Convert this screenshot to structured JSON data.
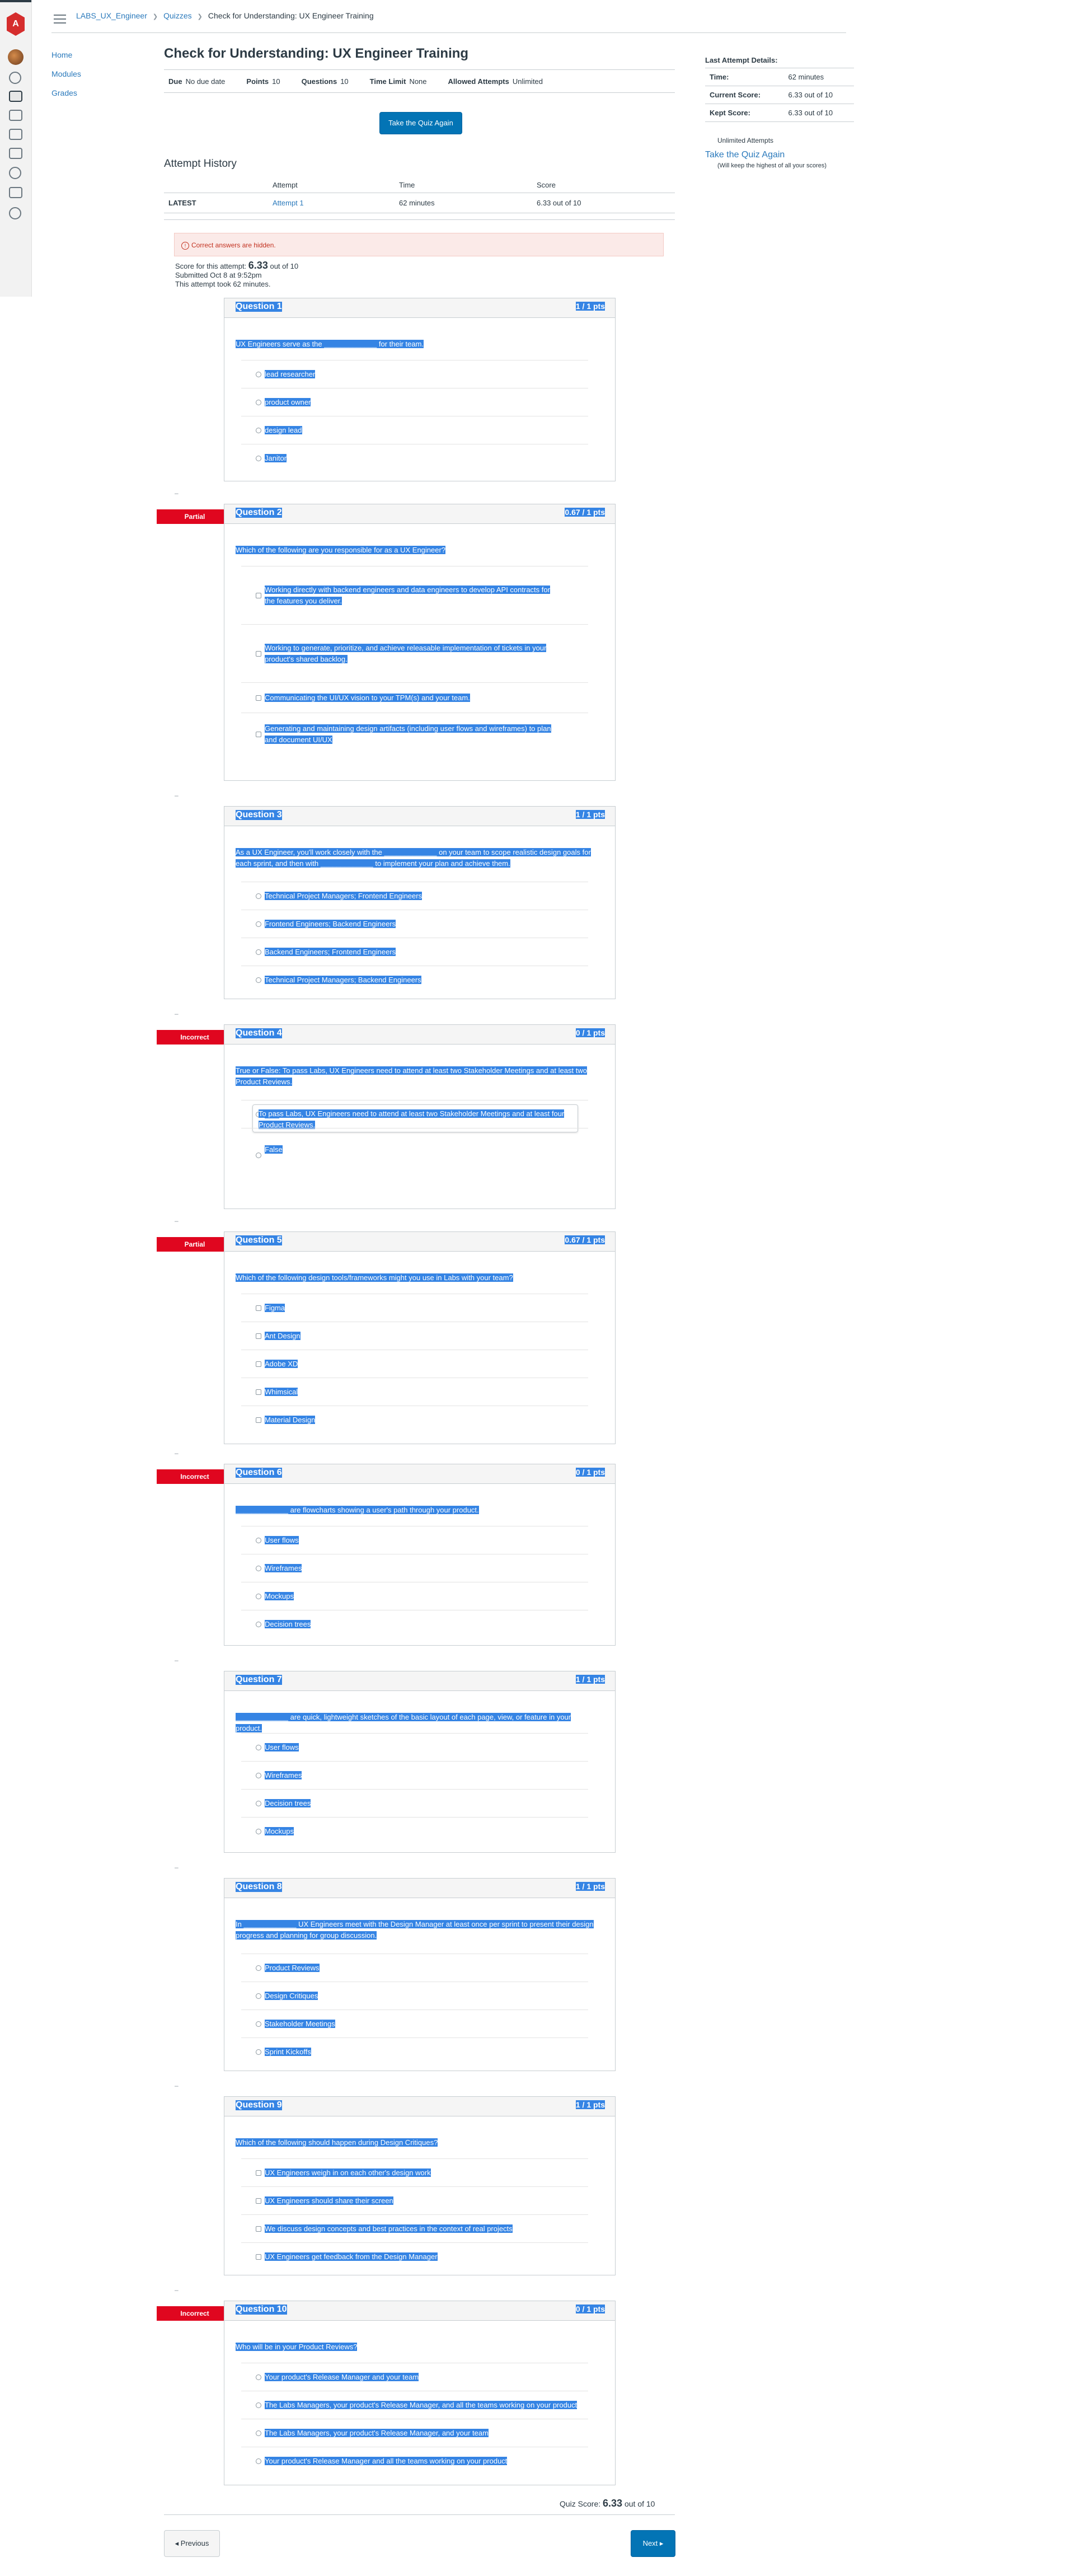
{
  "breadcrumb": {
    "course": "LABS_UX_Engineer",
    "section": "Quizzes",
    "current": "Check for Understanding: UX Engineer Training"
  },
  "course_nav": [
    "Home",
    "Modules",
    "Grades"
  ],
  "quiz": {
    "title": "Check for Understanding: UX Engineer Training",
    "details": [
      {
        "label": "Due",
        "value": "No due date"
      },
      {
        "label": "Points",
        "value": "10"
      },
      {
        "label": "Questions",
        "value": "10"
      },
      {
        "label": "Time Limit",
        "value": "None"
      },
      {
        "label": "Allowed Attempts",
        "value": "Unlimited"
      }
    ],
    "take_again": "Take the Quiz Again"
  },
  "history": {
    "title": "Attempt History",
    "headers": [
      "",
      "Attempt",
      "Time",
      "Score"
    ],
    "row": [
      "LATEST",
      "Attempt 1",
      "62 minutes",
      "6.33 out of 10"
    ]
  },
  "alert": "Correct answers are hidden.",
  "attempt": {
    "score_label": "Score for this attempt:",
    "score": "6.33",
    "score_suffix": "out of 10",
    "submitted": "Submitted Oct 8 at 9:52pm",
    "took": "This attempt took 62 minutes."
  },
  "questions": [
    {
      "title": "Question 1",
      "pts": "1 / 1 pts",
      "flag": "",
      "text": "UX Engineers serve as the _____________ for their team.",
      "answers": [
        "lead researcher",
        "product owner",
        "design lead",
        "Janitor"
      ]
    },
    {
      "title": "Question 2",
      "pts": "0.67 / 1 pts",
      "flag": "Partial",
      "text": "Which of the following are you responsible for as a UX Engineer?",
      "answers": [
        "Working directly with backend engineers and data engineers to develop API contracts for the features you deliver.",
        "Working to generate, prioritize, and achieve releasable implementation of tickets in your product's shared backlog.",
        "Communicating the UI/UX vision to your TPM(s) and your team.",
        "Generating and maintaining design artifacts (including user flows and wireframes) to plan and document UI/UX"
      ]
    },
    {
      "title": "Question 3",
      "pts": "1 / 1 pts",
      "flag": "",
      "text": "As a UX Engineer, you'll work closely with the _____________ on your team to scope realistic design goals for each sprint, and then with _____________ to implement your plan and achieve them.",
      "answers": [
        "Technical Project Managers; Frontend Engineers",
        "Frontend Engineers; Backend Engineers",
        "Backend Engineers; Frontend Engineers",
        "Technical Project Managers; Backend Engineers"
      ]
    },
    {
      "title": "Question 4",
      "pts": "0 / 1 pts",
      "flag": "Incorrect",
      "text": "True or False: To pass Labs, UX Engineers need to attend at least two Stakeholder Meetings and at least two Product Reviews.",
      "answers": [
        "True",
        "False"
      ],
      "feedback": "To pass Labs, UX Engineers need to attend at least two Stakeholder Meetings and at least four Product Reviews."
    },
    {
      "title": "Question 5",
      "pts": "0.67 / 1 pts",
      "flag": "Partial",
      "text": "Which of the following design tools/frameworks might you use in Labs with your team?",
      "answers": [
        "Figma",
        "Ant Design",
        "Adobe XD",
        "Whimsical",
        "Material Design"
      ]
    },
    {
      "title": "Question 6",
      "pts": "0 / 1 pts",
      "flag": "Incorrect",
      "text": "_____________ are flowcharts showing a user's path through your product.",
      "answers": [
        "User flows",
        "Wireframes",
        "Mockups",
        "Decision trees"
      ]
    },
    {
      "title": "Question 7",
      "pts": "1 / 1 pts",
      "flag": "",
      "text": "_____________ are quick, lightweight sketches of the basic layout of each page, view, or feature in your product.",
      "answers": [
        "User flows",
        "Wireframes",
        "Decision trees",
        "Mockups"
      ]
    },
    {
      "title": "Question 8",
      "pts": "1 / 1 pts",
      "flag": "",
      "text": "In _____________ UX Engineers meet with the Design Manager at least once per sprint to present their design progress and planning for group discussion.",
      "answers": [
        "Product Reviews",
        "Design Critiques",
        "Stakeholder Meetings",
        "Sprint Kickoffs"
      ]
    },
    {
      "title": "Question 9",
      "pts": "1 / 1 pts",
      "flag": "",
      "text": "Which of the following should happen during Design Critiques?",
      "answers": [
        "UX Engineers weigh in on each other's design work",
        "UX Engineers should share their screen",
        "We discuss design concepts and best practices in the context of real projects",
        "UX Engineers get feedback from the Design Manager"
      ]
    },
    {
      "title": "Question 10",
      "pts": "0 / 1 pts",
      "flag": "Incorrect",
      "text": "Who will be in your Product Reviews?",
      "answers": [
        "Your product's Release Manager and your team",
        "The Labs Managers, your product's Release Manager, and all the teams working on your product",
        "The Labs Managers, your product's Release Manager, and your team",
        "Your product's Release Manager and all the teams working on your product"
      ]
    }
  ],
  "quiz_score": {
    "label": "Quiz Score:",
    "value": "6.33",
    "suffix": "out of 10"
  },
  "pager": {
    "prev": "◂ Previous",
    "next": "Next ▸"
  },
  "sidebar": {
    "title": "Last Attempt Details:",
    "rows": [
      [
        "Time:",
        "62 minutes"
      ],
      [
        "Current Score:",
        "6.33 out of 10"
      ],
      [
        "Kept Score:",
        "6.33 out of 10"
      ]
    ],
    "unlimited": "Unlimited Attempts",
    "take_again": "Take the Quiz Again",
    "keep": "(Will keep the highest of all your scores)"
  }
}
